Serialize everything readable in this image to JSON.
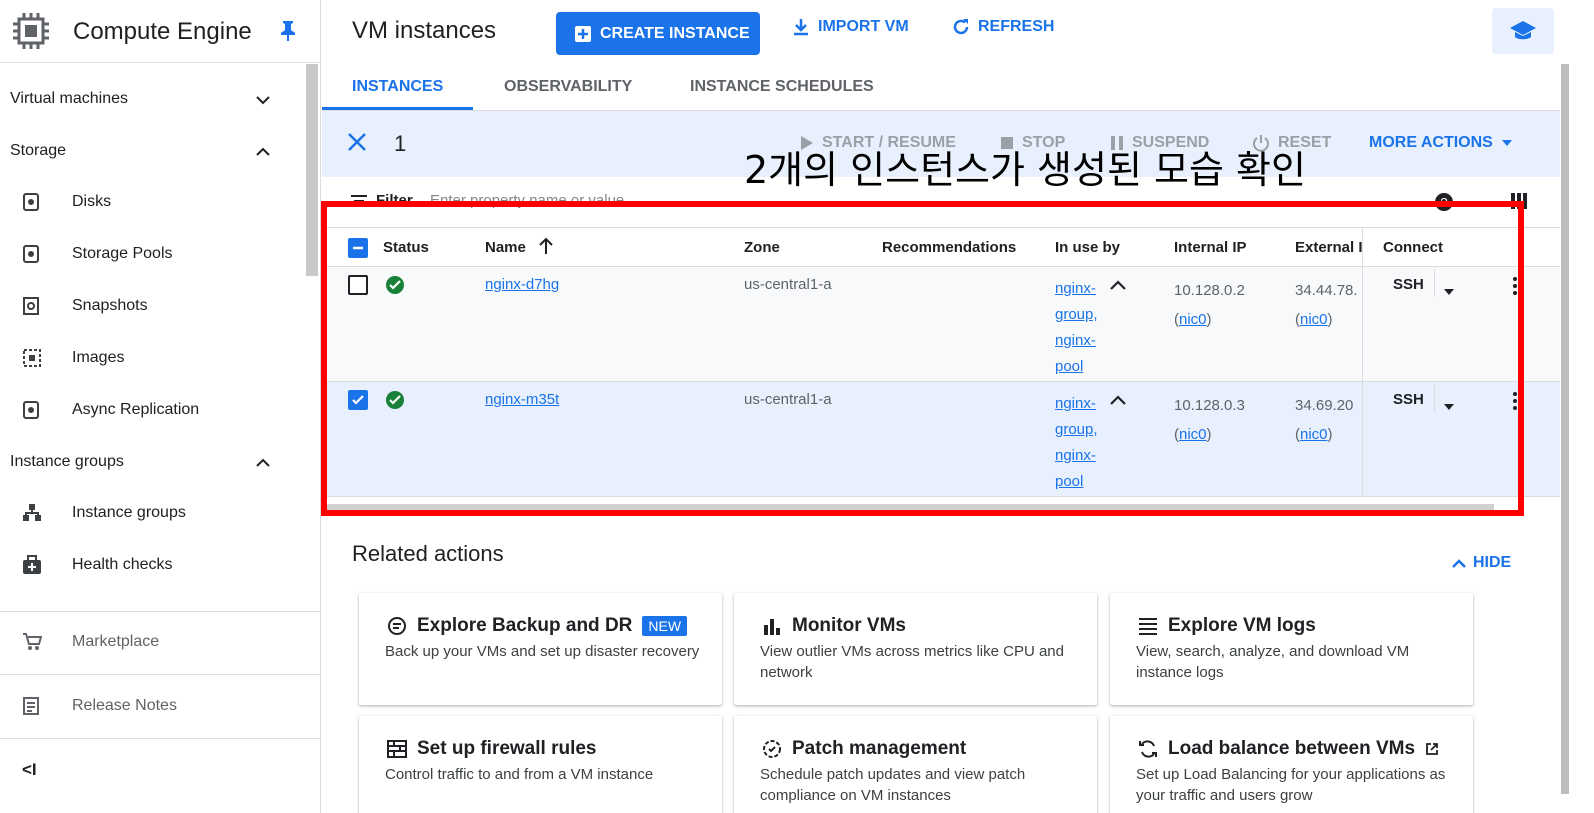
{
  "sidebar": {
    "title": "Compute Engine",
    "sections": [
      {
        "label": "Virtual machines"
      },
      {
        "label": "Storage"
      },
      {
        "label": "Instance groups"
      }
    ],
    "items": [
      {
        "label": "Disks"
      },
      {
        "label": "Storage Pools"
      },
      {
        "label": "Snapshots"
      },
      {
        "label": "Images"
      },
      {
        "label": "Async Replication"
      },
      {
        "label": "Instance groups"
      },
      {
        "label": "Health checks"
      },
      {
        "label": "Marketplace"
      },
      {
        "label": "Release Notes"
      }
    ],
    "collapse_glyph": "<I"
  },
  "header": {
    "title": "VM instances",
    "create": "CREATE INSTANCE",
    "import": "IMPORT VM",
    "refresh": "REFRESH"
  },
  "tabs": [
    {
      "label": "INSTANCES"
    },
    {
      "label": "OBSERVABILITY"
    },
    {
      "label": "INSTANCE SCHEDULES"
    }
  ],
  "selection": {
    "count": "1",
    "start": "START / RESUME",
    "stop": "STOP",
    "suspend": "SUSPEND",
    "reset": "RESET",
    "more": "MORE ACTIONS"
  },
  "filter": {
    "label": "Filter",
    "placeholder": "Enter property name or value"
  },
  "table": {
    "columns": [
      "Status",
      "Name",
      "Zone",
      "Recommendations",
      "In use by",
      "Internal IP",
      "External IP",
      "Connect"
    ],
    "rows": [
      {
        "name": "nginx-d7hg",
        "zone": "us-central1-a",
        "in_use_by": [
          "nginx-",
          "group,",
          "nginx-",
          "pool"
        ],
        "internal_ip": "10.128.0.2",
        "internal_nic": "nic0",
        "external_ip": "34.44.78.",
        "external_nic": "nic0",
        "connect": "SSH",
        "selected": false
      },
      {
        "name": "nginx-m35t",
        "zone": "us-central1-a",
        "in_use_by": [
          "nginx-",
          "group,",
          "nginx-",
          "pool"
        ],
        "internal_ip": "10.128.0.3",
        "internal_nic": "nic0",
        "external_ip": "34.69.20",
        "external_nic": "nic0",
        "connect": "SSH",
        "selected": true
      }
    ]
  },
  "annotation": "2개의 인스턴스가 생성된 모습 확인",
  "related": {
    "title": "Related actions",
    "hide": "HIDE",
    "cards": [
      {
        "title": "Explore Backup and DR",
        "badge": "NEW",
        "desc": "Back up your VMs and set up disaster recovery",
        "icon": "backup-icon"
      },
      {
        "title": "Monitor VMs",
        "desc": "View outlier VMs across metrics like CPU and network",
        "icon": "bar-chart-icon"
      },
      {
        "title": "Explore VM logs",
        "desc": "View, search, analyze, and download VM instance logs",
        "icon": "logs-icon"
      },
      {
        "title": "Set up firewall rules",
        "desc": "Control traffic to and from a VM instance",
        "icon": "firewall-icon"
      },
      {
        "title": "Patch management",
        "desc": "Schedule patch updates and view patch compliance on VM instances",
        "icon": "patch-icon"
      },
      {
        "title": "Load balance between VMs",
        "desc": "Set up Load Balancing for your applications as your traffic and users grow",
        "icon": "load-balance-icon"
      }
    ]
  },
  "colors": {
    "accent": "#1a73e8",
    "success": "#188038",
    "highlight": "#ff0000"
  }
}
